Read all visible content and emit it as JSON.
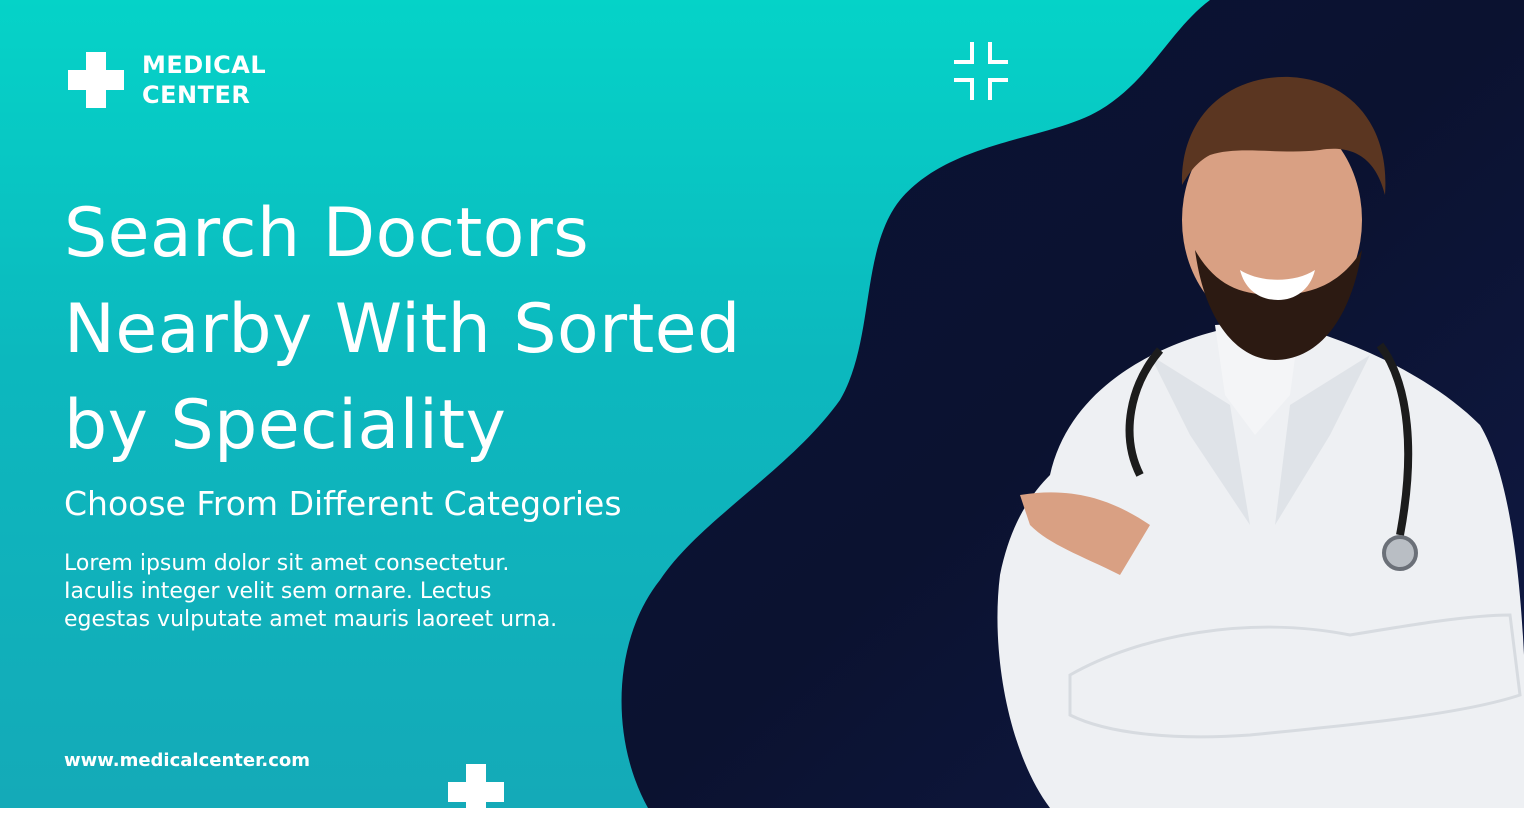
{
  "brand": {
    "name_line1": "MEDICAL",
    "name_line2": "CENTER",
    "icon": "cross-icon"
  },
  "hero": {
    "title_line1": "Search Doctors",
    "title_line2": "Nearby With Sorted",
    "title_line3": "by Speciality",
    "subtitle": "Choose From Different Categories",
    "description": "Lorem ipsum dolor sit amet consectetur. Iaculis integer velit sem ornare. Lectus egestas vulputate amet mauris laoreet urna."
  },
  "footer": {
    "website": "www.medicalcenter.com"
  },
  "decor": {
    "corner_icon": "frame-corners-icon",
    "bottom_icon": "cross-icon"
  },
  "colors": {
    "teal_top": "#05d3c8",
    "teal_bottom": "#14aab8",
    "navy": "#0b1230",
    "white": "#ffffff"
  }
}
